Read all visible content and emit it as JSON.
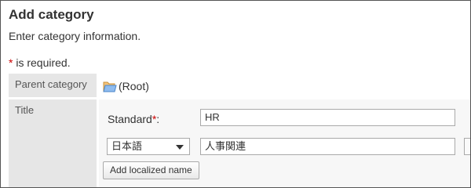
{
  "header": {
    "title": "Add category",
    "description": "Enter category information."
  },
  "required_note": {
    "star": "*",
    "text": " is required."
  },
  "form": {
    "parent_category": {
      "label": "Parent category",
      "value": "(Root)",
      "icon": "folder-icon"
    },
    "title": {
      "label": "Title",
      "standard_label": "Standard",
      "required_star": "*",
      "colon": ":",
      "standard_value": "HR",
      "language_selected": "日本語",
      "localized_value": "人事関連",
      "add_localized_label": "Add localized name"
    }
  },
  "colors": {
    "label_bg": "#e6e6e6",
    "required": "#cc0000"
  }
}
